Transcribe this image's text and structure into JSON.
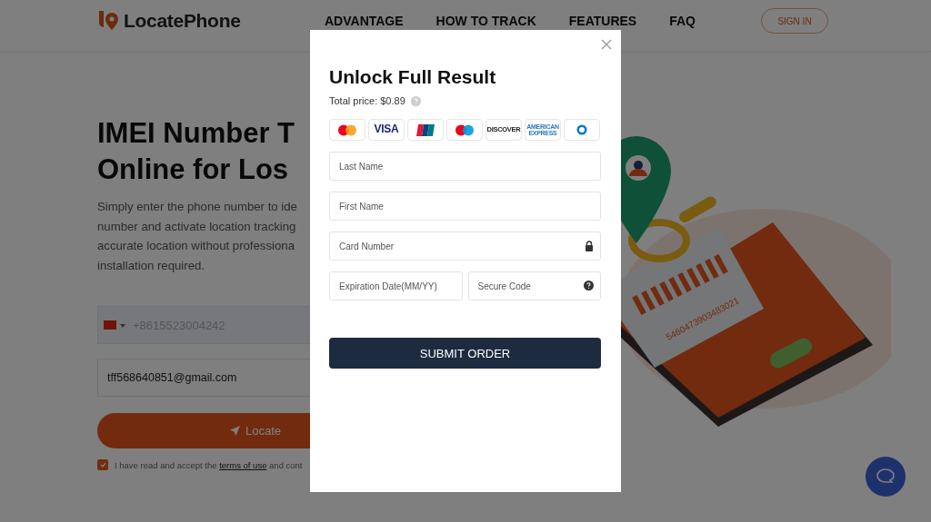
{
  "header": {
    "brand": "LocatePhone",
    "nav": [
      {
        "label": "ADVANTAGE"
      },
      {
        "label": "HOW TO TRACK"
      },
      {
        "label": "FEATURES"
      },
      {
        "label": "FAQ"
      }
    ],
    "sign_in": "SIGN IN"
  },
  "hero": {
    "title_lines": [
      "IMEI Number T",
      "Online for Los"
    ],
    "description_lines": [
      "Simply enter the phone number to ide",
      "number and activate location tracking",
      "accurate location without professiona",
      "installation required."
    ],
    "phone_field": {
      "placeholder": "+8615523004242"
    },
    "email_field": {
      "value": "tff568640851@gmail.com"
    },
    "locate_button": "Locate",
    "terms": {
      "checked": true,
      "before": "I have read and accept the ",
      "link": "terms of use",
      "after": " and cont"
    }
  },
  "illustration": {
    "barcode_number": "5460473903483021"
  },
  "modal": {
    "title": "Unlock Full Result",
    "price": "Total price: $0.89",
    "cards": [
      {
        "kind": "mastercard"
      },
      {
        "kind": "word",
        "label": "VISA"
      },
      {
        "kind": "unionpay"
      },
      {
        "kind": "maestro"
      },
      {
        "kind": "word",
        "label": "DISCOVER"
      },
      {
        "kind": "word",
        "label": "AMERICAN EXPRESS"
      },
      {
        "kind": "diners"
      }
    ],
    "fields": [
      {
        "kind": "text",
        "placeholder": "Last Name"
      },
      {
        "kind": "text",
        "placeholder": "First Name"
      },
      {
        "kind": "card",
        "placeholder": "Card Number"
      }
    ],
    "split_fields": [
      {
        "kind": "text",
        "placeholder": "Expiration Date(MM/YY)"
      },
      {
        "kind": "code",
        "placeholder": "Secure Code"
      }
    ],
    "submit": "SUBMIT ORDER"
  }
}
